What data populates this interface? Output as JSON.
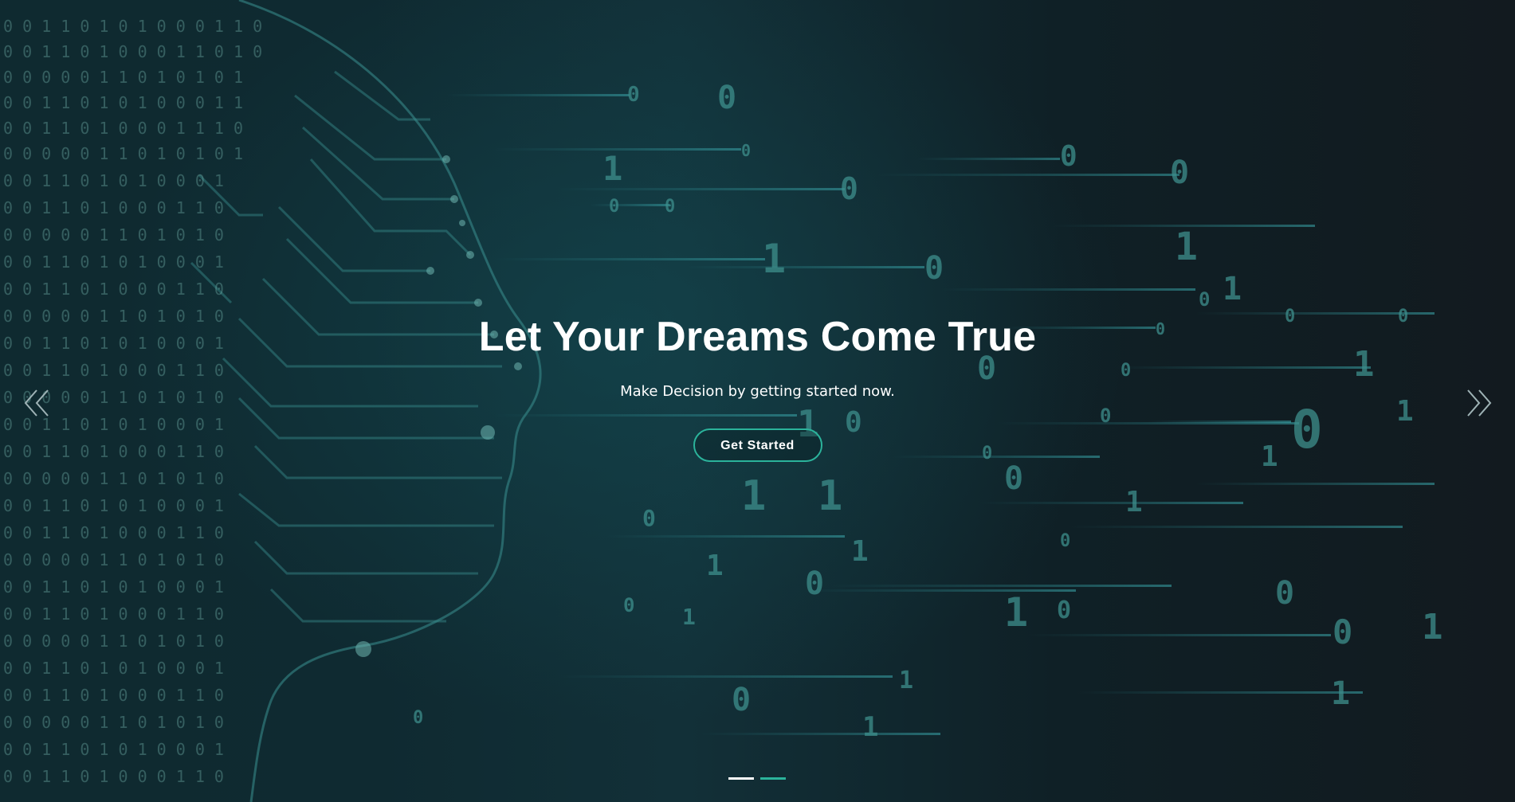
{
  "hero": {
    "title": "Let Your Dreams Come True",
    "subtitle": "Make Decision by getting started now.",
    "cta_label": "Get Started",
    "background_description_icon": "circuit-face-binary-icon"
  },
  "carousel": {
    "prev_icon": "double-chevron-left-icon",
    "next_icon": "double-chevron-right-icon",
    "slide_count": 2,
    "active_indicator_index": 0
  },
  "colors": {
    "accent": "#2bb39b",
    "text": "#ffffff",
    "background_dark": "#0f2a30"
  }
}
